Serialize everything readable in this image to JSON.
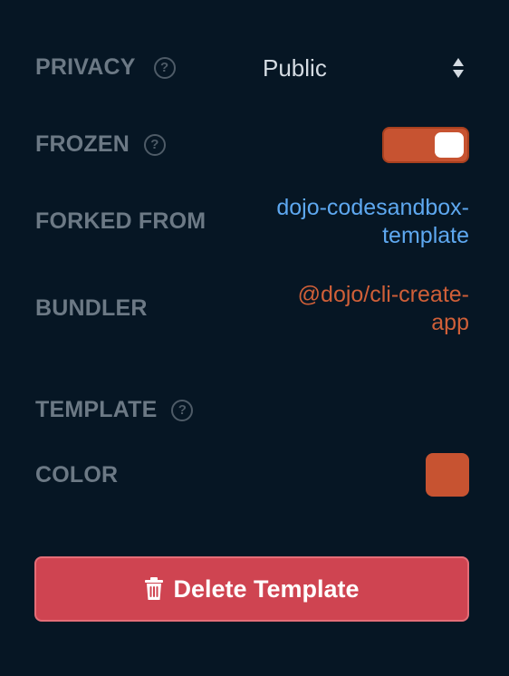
{
  "settings": {
    "privacy": {
      "label": "PRIVACY",
      "value": "Public",
      "help_icon": "question-circle-icon"
    },
    "frozen": {
      "label": "FROZEN",
      "enabled": true,
      "help_icon": "question-circle-icon"
    },
    "forked_from": {
      "label": "FORKED FROM",
      "value_line1": "dojo-codesandbox-",
      "value_line2": "template"
    },
    "bundler": {
      "label": "BUNDLER",
      "value_line1": "@dojo/cli-create-",
      "value_line2": "app"
    },
    "template": {
      "label": "TEMPLATE",
      "help_icon": "question-circle-icon"
    },
    "color": {
      "label": "COLOR",
      "swatch": "#c75331"
    }
  },
  "help_glyph": "?",
  "delete_button": {
    "label": "Delete Template",
    "icon": "trash-icon"
  },
  "colors": {
    "background": "#061624",
    "label": "#6c7985",
    "link": "#5ea8f0",
    "accent": "#c75331",
    "danger": "#cf4451"
  }
}
